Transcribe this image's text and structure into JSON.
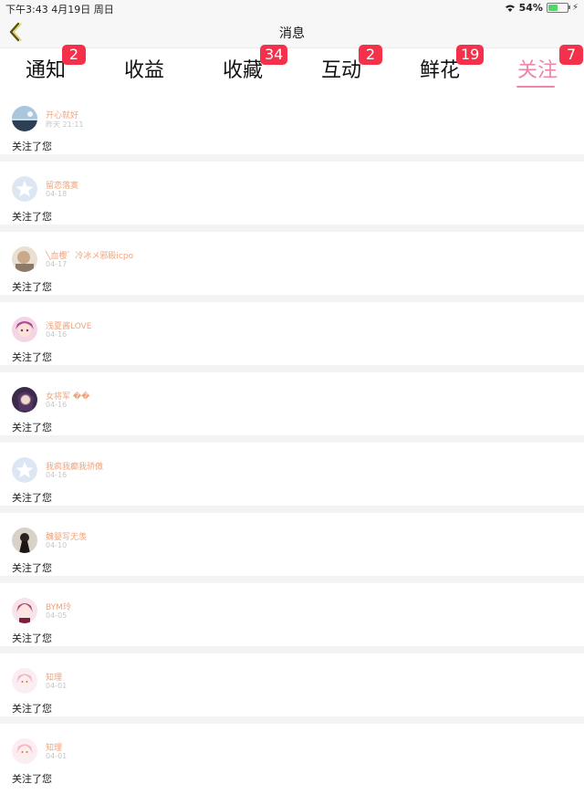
{
  "status": {
    "time": "下午3:43",
    "date": "4月19日 周日",
    "battery": "54%"
  },
  "nav": {
    "title": "消息"
  },
  "tabs": [
    {
      "label": "通知",
      "badge": "2"
    },
    {
      "label": "收益",
      "badge": ""
    },
    {
      "label": "收藏",
      "badge": "34"
    },
    {
      "label": "互动",
      "badge": "2"
    },
    {
      "label": "鲜花",
      "badge": "19"
    },
    {
      "label": "关注",
      "badge": "7"
    }
  ],
  "colors": {
    "accent": "#ef86a8",
    "badge": "#f5304a",
    "username": "#f0a27a"
  },
  "items": [
    {
      "name": "开心就好",
      "date": "昨天 21:11",
      "text": "关注了您",
      "avatar": "landscape-avatar"
    },
    {
      "name": "留恋落寞",
      "date": "04-18",
      "text": "关注了您",
      "avatar": "default-star-avatar"
    },
    {
      "name": "╲血櫻゛冷冰メ邪殿icpo",
      "date": "04-17",
      "text": "关注了您",
      "avatar": "photo-avatar"
    },
    {
      "name": "浅夏酱LOVE",
      "date": "04-16",
      "text": "关注了您",
      "avatar": "anime-avatar"
    },
    {
      "name": "女将军 ��",
      "date": "04-16",
      "text": "关注了您",
      "avatar": "dark-anime-avatar"
    },
    {
      "name": "我疯我癫我骄傲",
      "date": "04-16",
      "text": "关注了您",
      "avatar": "default-star-avatar"
    },
    {
      "name": "魏婴写无羡",
      "date": "04-10",
      "text": "关注了您",
      "avatar": "ink-avatar"
    },
    {
      "name": "BYM玲",
      "date": "04-05",
      "text": "关注了您",
      "avatar": "anime-avatar"
    },
    {
      "name": "知理",
      "date": "04-01",
      "text": "关注了您",
      "avatar": "pink-anime-avatar"
    },
    {
      "name": "知理",
      "date": "04-01",
      "text": "关注了您",
      "avatar": "pink-anime-avatar"
    }
  ]
}
